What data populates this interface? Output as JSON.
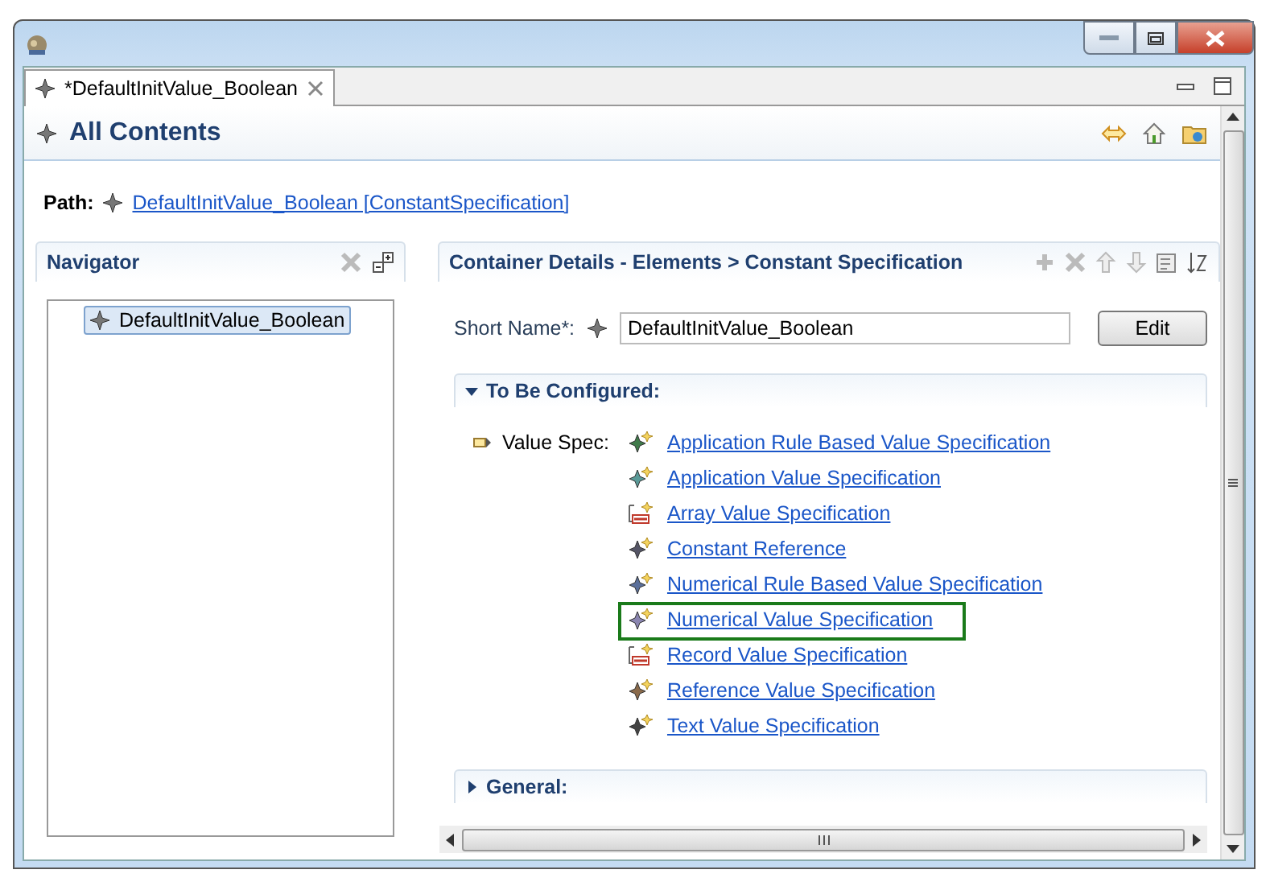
{
  "tab": {
    "label": "*DefaultInitValue_Boolean",
    "selected": true
  },
  "header": {
    "title": "All Contents"
  },
  "path": {
    "label": "Path:",
    "link": "DefaultInitValue_Boolean [ConstantSpecification]"
  },
  "navigator": {
    "title": "Navigator",
    "items": [
      {
        "label": "DefaultInitValue_Boolean",
        "selected": true
      }
    ]
  },
  "details": {
    "title": "Container Details - Elements > Constant Specification",
    "short_name": {
      "label": "Short Name*:",
      "value": "DefaultInitValue_Boolean",
      "button": "Edit"
    },
    "sections": [
      {
        "title": "To Be Configured:",
        "expanded": true,
        "field": "Value Spec:",
        "options": [
          {
            "label": "Application Rule Based Value Specification",
            "kind": "element",
            "color": "#3f7a4a",
            "highlighted": false
          },
          {
            "label": "Application Value Specification",
            "kind": "element",
            "color": "#5a9a98",
            "highlighted": false
          },
          {
            "label": "Array Value Specification",
            "kind": "composite",
            "color": "#c0392b",
            "highlighted": false
          },
          {
            "label": "Constant Reference",
            "kind": "element",
            "color": "#555566",
            "highlighted": false
          },
          {
            "label": "Numerical Rule Based Value Specification",
            "kind": "element",
            "color": "#5a6f9a",
            "highlighted": false
          },
          {
            "label": "Numerical Value Specification",
            "kind": "element",
            "color": "#8a85b0",
            "highlighted": true
          },
          {
            "label": "Record Value Specification",
            "kind": "composite",
            "color": "#c0392b",
            "highlighted": false
          },
          {
            "label": "Reference Value Specification",
            "kind": "element",
            "color": "#8a6a4a",
            "highlighted": false
          },
          {
            "label": "Text Value Specification",
            "kind": "element",
            "color": "#444444",
            "highlighted": false
          }
        ]
      },
      {
        "title": "General:",
        "expanded": false
      }
    ]
  }
}
